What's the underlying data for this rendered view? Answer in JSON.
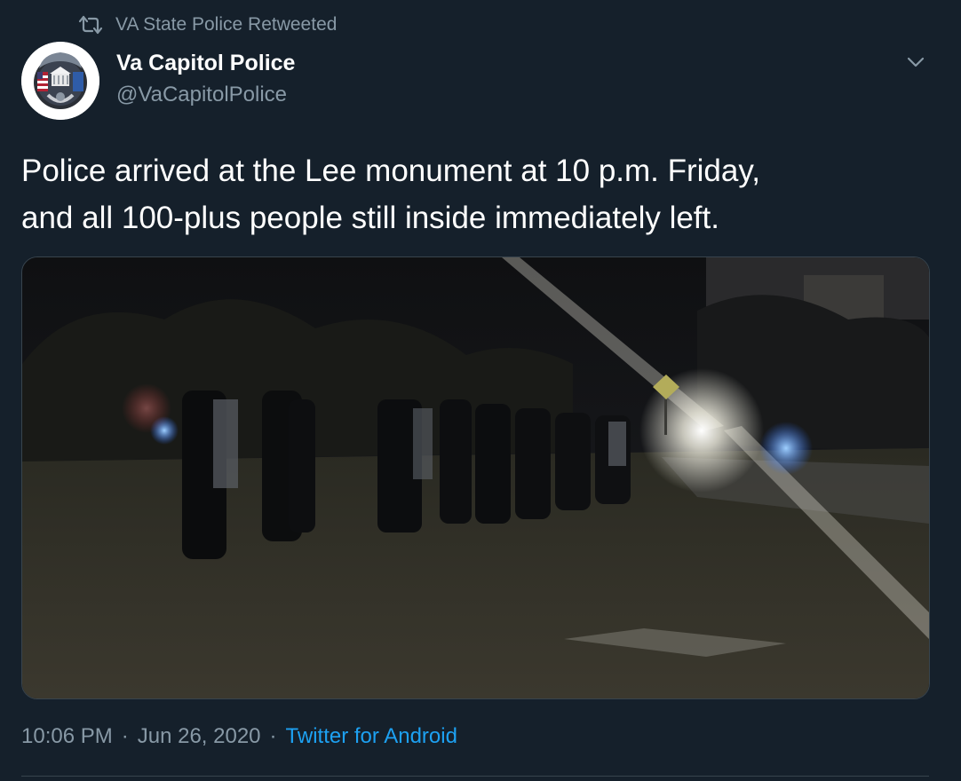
{
  "retweet": {
    "label": "VA State Police Retweeted",
    "icon": "retweet-icon"
  },
  "author": {
    "name": "Va Capitol Police",
    "handle": "@VaCapitolPolice",
    "avatar_icon": "police-badge-icon"
  },
  "menu": {
    "icon": "chevron-down-icon"
  },
  "tweet": {
    "text": "Police arrived at the Lee monument  at 10 p.m. Friday,\nand all 100-plus people still inside immediately left."
  },
  "meta": {
    "time": "10:06 PM",
    "separator": "·",
    "date": "Jun 26, 2020",
    "source": "Twitter for Android"
  },
  "colors": {
    "background": "#15202b",
    "primary_text": "#ffffff",
    "secondary_text": "#8899a6",
    "link": "#1da1f2",
    "border": "#38444d"
  }
}
